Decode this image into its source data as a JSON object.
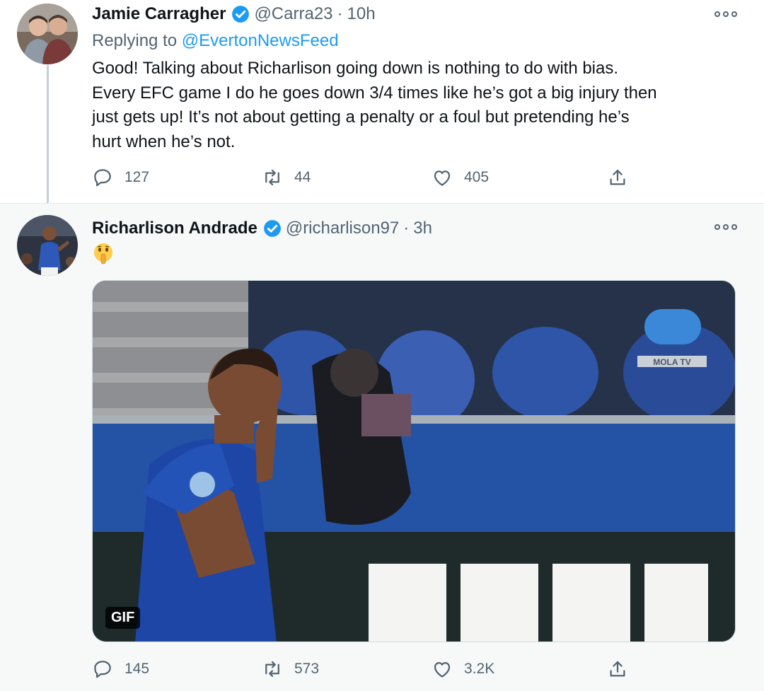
{
  "tweets": [
    {
      "author_name": "Jamie Carragher",
      "handle": "@Carra23",
      "separator": "·",
      "time": "10h",
      "replying_prefix": "Replying to",
      "replying_to": "@EvertonNewsFeed",
      "text_lines": [
        "Good! Talking about Richarlison going down is nothing to do with bias.",
        "Every EFC game I do he goes down 3/4 times like he’s got a big injury then",
        "just gets up! It’s not about getting a penalty or a foul but pretending he’s",
        "hurt when he’s not."
      ],
      "replies": "127",
      "retweets": "44",
      "likes": "405"
    },
    {
      "author_name": "Richarlison Andrade",
      "handle": "@richarlison97",
      "separator": "·",
      "time": "3h",
      "text_emoji": "shushing-face",
      "media_badge": "GIF",
      "media_watermark": "MOLA TV",
      "replies": "145",
      "retweets": "573",
      "likes": "3.2K"
    }
  ],
  "colors": {
    "accent": "#1d9bf0",
    "secondary_text": "#536471",
    "primary_text": "#0f1419"
  },
  "icons": [
    "verified-badge-icon",
    "more-options-icon",
    "reply-icon",
    "retweet-icon",
    "like-icon",
    "share-icon",
    "shushing-face-emoji"
  ]
}
